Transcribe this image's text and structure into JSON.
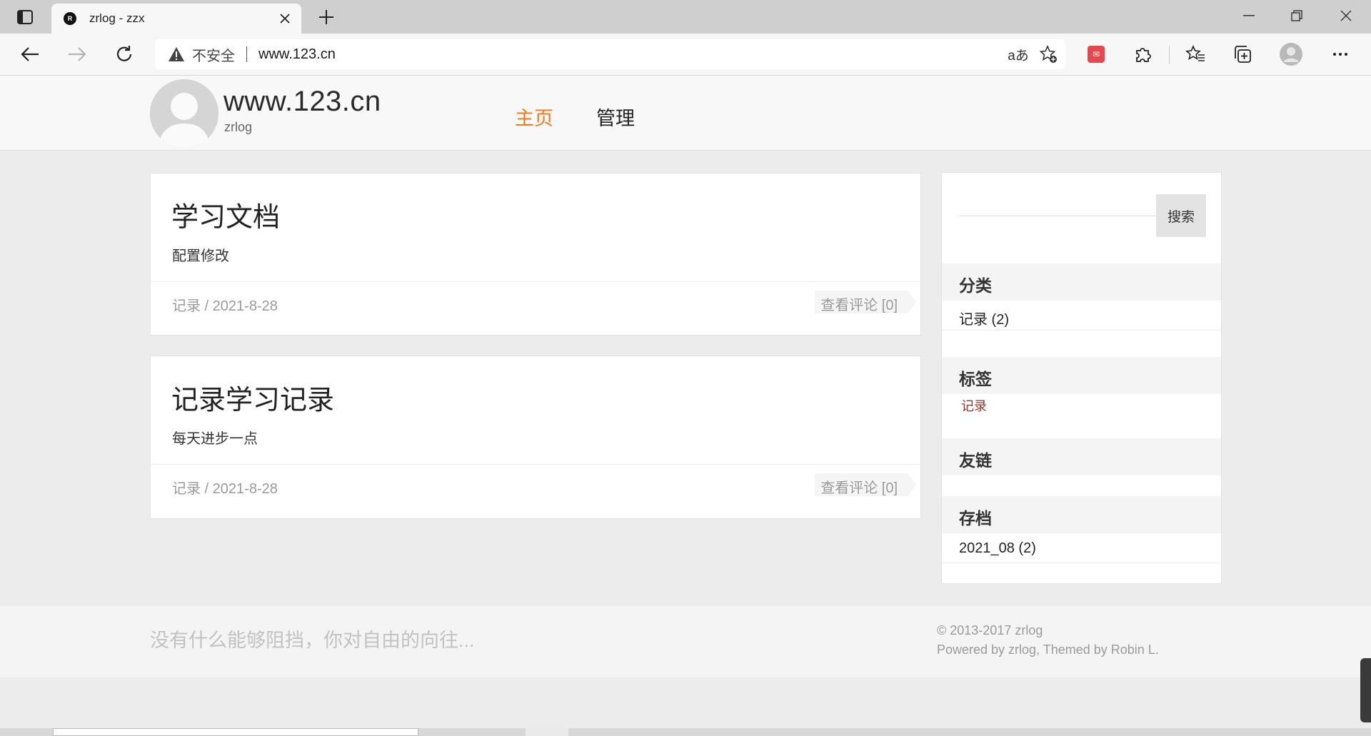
{
  "browser": {
    "tab_title": "zrlog - zzx",
    "tab_favicon_letter": "R",
    "insecure_label": "不安全",
    "url": "www.123.cn"
  },
  "site": {
    "title": "www.123.cn",
    "subtitle": "zrlog",
    "nav": [
      {
        "label": "主页",
        "active": true
      },
      {
        "label": "管理",
        "active": false
      }
    ],
    "accent_color": "#f07a1c"
  },
  "posts": [
    {
      "title": "学习文档",
      "summary": "配置修改",
      "meta": "记录 / 2021-8-28",
      "comments": "查看评论 [0]"
    },
    {
      "title": "记录学习记录",
      "summary": "每天进步一点",
      "meta": "记录 / 2021-8-28",
      "comments": "查看评论 [0]"
    }
  ],
  "sidebar": {
    "search_button": "搜索",
    "categories_title": "分类",
    "categories": [
      "记录 (2)"
    ],
    "tags_title": "标签",
    "tags": [
      "记录"
    ],
    "links_title": "友链",
    "archives_title": "存档",
    "archives": [
      "2021_08 (2)"
    ]
  },
  "footer": {
    "slogan": "没有什么能够阻挡，你对自由的向往...",
    "copyright": "© 2013-2017 zrlog",
    "powered": "Powered by zrlog, Themed by Robin L."
  }
}
